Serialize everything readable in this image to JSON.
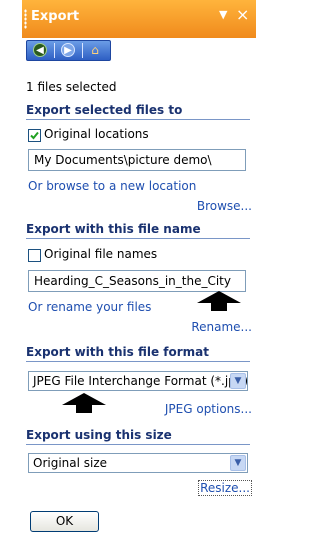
{
  "pane": {
    "title": "Export",
    "dropdown_icon": "▼",
    "close_icon": "×"
  },
  "nav": {
    "back_icon": "back-arrow-icon",
    "forward_icon": "forward-arrow-icon",
    "home_icon": "home-icon"
  },
  "status": "1 files selected",
  "location": {
    "heading": "Export selected files to",
    "checkbox_label": "Original locations",
    "checked": true,
    "path": "My Documents\\picture demo\\",
    "browse_hint": "Or browse to a new location",
    "browse_link": "Browse..."
  },
  "filename": {
    "heading": "Export with this file name",
    "checkbox_label": "Original file names",
    "checked": false,
    "value": "Hearding_C_Seasons_in_the_City",
    "rename_hint": "Or rename your files",
    "rename_link": "Rename..."
  },
  "format": {
    "heading": "Export with this file format",
    "selected": "JPEG File Interchange Format (*.jpg)",
    "options_link": "JPEG options..."
  },
  "size": {
    "heading": "Export using this size",
    "selected": "Original size",
    "resize_link": "Resize..."
  },
  "ok_label": "OK",
  "colors": {
    "titlebar": "#f08a1c",
    "heading": "#1a3270",
    "link": "#1f4fb0",
    "nav": "#2e5fc4"
  }
}
